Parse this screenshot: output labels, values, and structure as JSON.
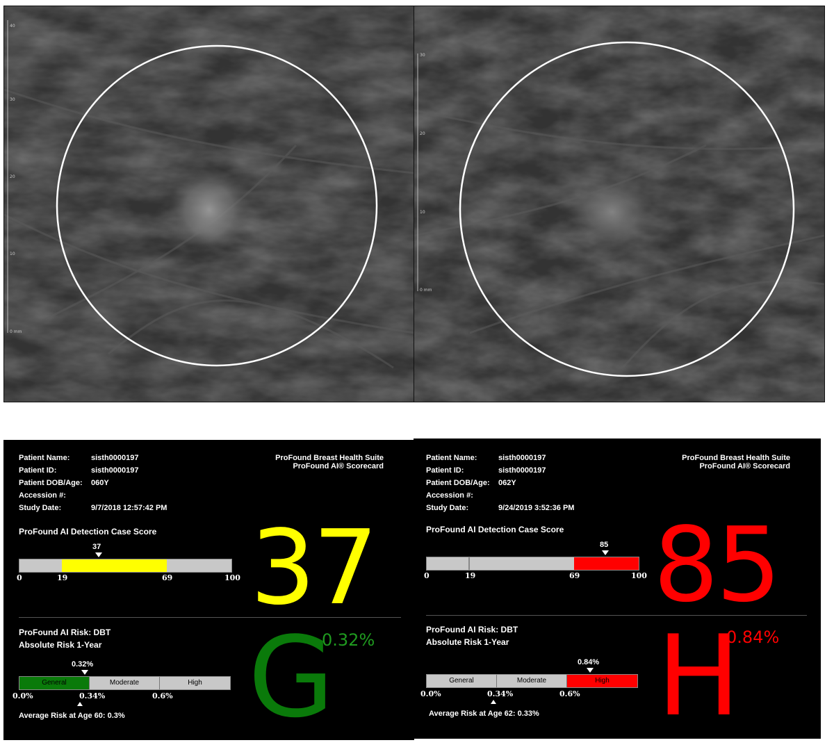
{
  "images": [
    {
      "name": "prior-mammogram",
      "scale_ticks": [
        "40",
        "30",
        "20",
        "10",
        "0 mm"
      ]
    },
    {
      "name": "current-mammogram",
      "scale_ticks": [
        "30",
        "20",
        "10",
        "0 mm"
      ]
    }
  ],
  "scorecards": [
    {
      "patient": {
        "name_label": "Patient Name:",
        "name": "sisth0000197",
        "id_label": "Patient ID:",
        "id": "sisth0000197",
        "dob_label": "Patient DOB/Age:",
        "dob": "060Y",
        "accession_label": "Accession #:",
        "accession": "",
        "study_label": "Study Date:",
        "study_date": "9/7/2018 12:57:42 PM"
      },
      "brand_line1": "ProFound Breast Health Suite",
      "brand_line2": "ProFound AI® Scorecard",
      "detection_title": "ProFound AI Detection Case Score",
      "score": 37,
      "score_text": "37",
      "score_ticks": [
        "0",
        "19",
        "69",
        "100"
      ],
      "score_color": "#ffff00",
      "risk_title1": "ProFound AI Risk: DBT",
      "risk_title2": "Absolute Risk 1-Year",
      "risk_marker_text": "0.32%",
      "risk_value_pct": 0.32,
      "risk_categories": [
        "General",
        "Moderate",
        "High"
      ],
      "active_category": 0,
      "risk_ticks": [
        "0.0%",
        "0.34%",
        "0.6%"
      ],
      "avg_risk": "Average Risk at Age 60: 0.3%",
      "risk_letter": "G",
      "risk_pct": "0.32%",
      "risk_color": "#0a7a0a",
      "risk_pct_color": "#1f9a1f"
    },
    {
      "patient": {
        "name_label": "Patient Name:",
        "name": "sisth0000197",
        "id_label": "Patient ID:",
        "id": "sisth0000197",
        "dob_label": "Patient DOB/Age:",
        "dob": "062Y",
        "accession_label": "Accession #:",
        "accession": "",
        "study_label": "Study Date:",
        "study_date": "9/24/2019 3:52:36 PM"
      },
      "brand_line1": "ProFound Breast Health Suite",
      "brand_line2": "ProFound AI® Scorecard",
      "detection_title": "ProFound AI Detection Case Score",
      "score": 85,
      "score_text": "85",
      "score_ticks": [
        "0",
        "19",
        "69",
        "100"
      ],
      "score_color": "#ff0000",
      "risk_title1": "ProFound AI Risk: DBT",
      "risk_title2": "Absolute Risk 1-Year",
      "risk_marker_text": "0.84%",
      "risk_value_pct": 0.84,
      "risk_categories": [
        "General",
        "Moderate",
        "High"
      ],
      "active_category": 2,
      "risk_ticks": [
        "0.0%",
        "0.34%",
        "0.6%"
      ],
      "avg_risk": "Average Risk at Age 62: 0.33%",
      "risk_letter": "H",
      "risk_pct": "0.84%",
      "risk_color": "#ff0000",
      "risk_pct_color": "#ff0000"
    }
  ]
}
